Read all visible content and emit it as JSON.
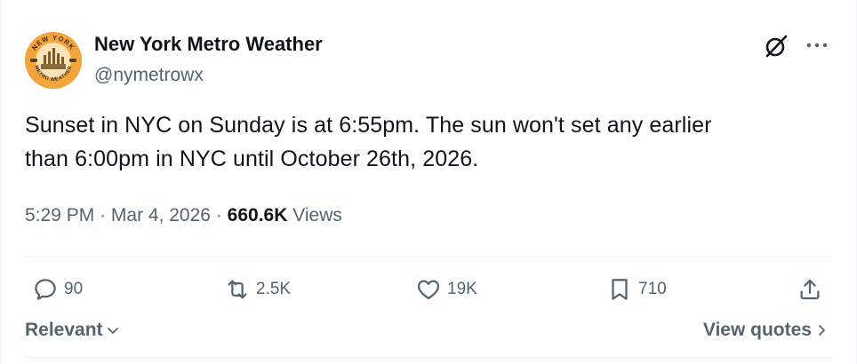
{
  "author": {
    "name": "New York Metro Weather",
    "handle": "@nymetrowx",
    "avatar_text_top": "NEW YORK",
    "avatar_text_bottom": "METRO WEATHER",
    "avatar_color": "#f3a43a"
  },
  "tweet": {
    "line1": "Sunset in NYC on Sunday is at 6:55pm. The sun won't set any earlier",
    "line2": "than 6:00pm in NYC until October 26th, 2026."
  },
  "meta": {
    "time": "5:29 PM",
    "separator": "·",
    "date": "Mar 4, 2026",
    "views_count": "660.6K",
    "views_label": "Views"
  },
  "actions": {
    "replies": "90",
    "reposts": "2.5K",
    "likes": "19K",
    "bookmarks": "710"
  },
  "footer": {
    "relevant_label": "Relevant",
    "view_quotes_label": "View quotes"
  },
  "icons": [
    "grok-icon",
    "more-icon",
    "reply-icon",
    "repost-icon",
    "like-icon",
    "bookmark-icon",
    "share-icon",
    "chevron-down-icon",
    "chevron-right-icon"
  ],
  "colors": {
    "text": "#0f1419",
    "secondary": "#536471",
    "divider": "#eff3f4"
  }
}
